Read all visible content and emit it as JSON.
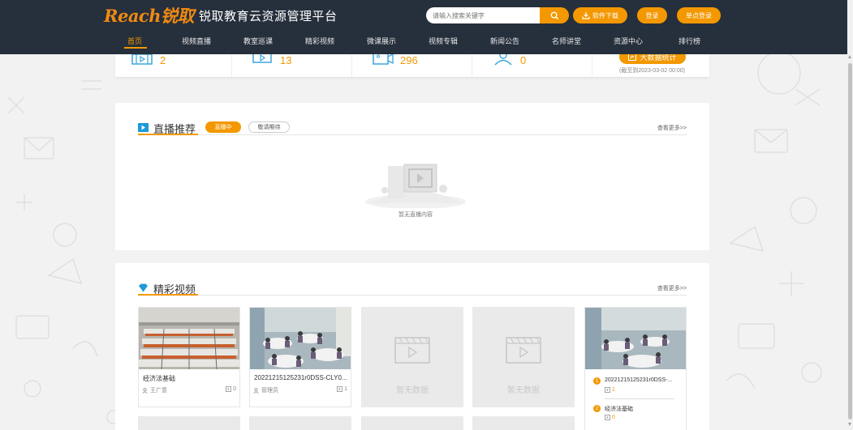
{
  "header": {
    "logo_text": "Reach锐取",
    "title": "锐取教育云资源管理平台",
    "search_placeholder": "请输入搜索关键字",
    "download_label": "软件下载",
    "login_label": "登录",
    "sso_label": "单点登录"
  },
  "nav": {
    "items": [
      {
        "label": "首页"
      },
      {
        "label": "视频直播"
      },
      {
        "label": "教室巡课"
      },
      {
        "label": "精彩视频"
      },
      {
        "label": "微课展示"
      },
      {
        "label": "视频专辑"
      },
      {
        "label": "新闻公告"
      },
      {
        "label": "名师讲堂"
      },
      {
        "label": "资源中心"
      },
      {
        "label": "排行榜"
      }
    ],
    "active_index": 0
  },
  "stats": {
    "values": [
      "2",
      "13",
      "296",
      "0"
    ],
    "stats_button_label": "大数据统计",
    "cutoff_text": "(截至到2023-03-02 00:00)"
  },
  "live_section": {
    "title": "直播推荐",
    "tag_live": "直播中",
    "tag_upcoming": "敬请期待",
    "more": "查看更多>>",
    "empty_text": "暂无直播内容"
  },
  "video_section": {
    "title": "精彩视频",
    "more": "查看更多>>",
    "cards": [
      {
        "title": "经济法基础",
        "author": "王广意",
        "count": "0"
      },
      {
        "title": "20221215125231r0DSS-CLY0...",
        "author": "管理员",
        "count": "1"
      }
    ],
    "empty_card_text": "暂无数据",
    "ranking": [
      {
        "rank": "1",
        "title": "20221215125231r0DSS-...",
        "count": "1"
      },
      {
        "rank": "2",
        "title": "经济法基础",
        "count": "0"
      }
    ]
  },
  "colors": {
    "header_bg": "#262f3c",
    "accent": "#f39800",
    "nav_active": "#f39800"
  }
}
